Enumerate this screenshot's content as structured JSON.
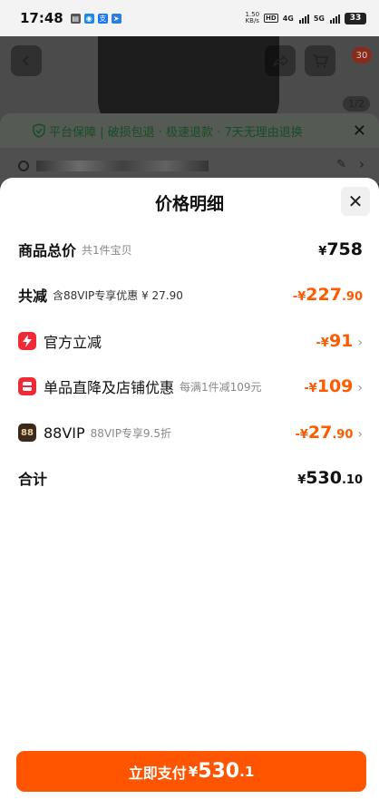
{
  "status_bar": {
    "time": "17:48",
    "net_speed_value": "1.50",
    "net_speed_unit": "KB/s",
    "hd_label": "HD",
    "signal1_label": "4G",
    "signal2_label": "5G",
    "battery": "33",
    "app_icons": [
      "message-icon",
      "wechat-icon",
      "alipay-icon",
      "navigation-icon"
    ]
  },
  "background_page": {
    "pager": "1/2",
    "cart_badge": "30",
    "guarantee_text": "平台保障 | 破损包退 · 极速退款 · 7天无理由退换"
  },
  "sheet": {
    "title": "价格明细",
    "rows": [
      {
        "label": "商品总价",
        "sub": "共1件宝贝",
        "currency": "¥",
        "int": "758",
        "dec": ""
      },
      {
        "label": "共减",
        "sub": "含88VIP专享优惠 ¥ 27.90",
        "currency": "-¥",
        "int": "227",
        "dec": ".90"
      },
      {
        "label": "官方立减",
        "sub": "",
        "currency": "-¥",
        "int": "91",
        "dec": ""
      },
      {
        "label": "单品直降及店铺优惠",
        "sub": "每满1件减109元",
        "currency": "-¥",
        "int": "109",
        "dec": ""
      },
      {
        "label": "88VIP",
        "sub": "88VIP专享9.5折",
        "currency": "-¥",
        "int": "27",
        "dec": ".90",
        "badge": "88"
      },
      {
        "label": "合计",
        "sub": "",
        "currency": "¥",
        "int": "530",
        "dec": ".10"
      }
    ]
  },
  "pay_button": {
    "label": "立即支付",
    "currency": "¥",
    "int": "530",
    "dec": ".1"
  },
  "colors": {
    "accent": "#ff5500",
    "discount": "#ff5a00",
    "official_icon": "#f02a35",
    "vip_icon": "#3b2a1c"
  }
}
